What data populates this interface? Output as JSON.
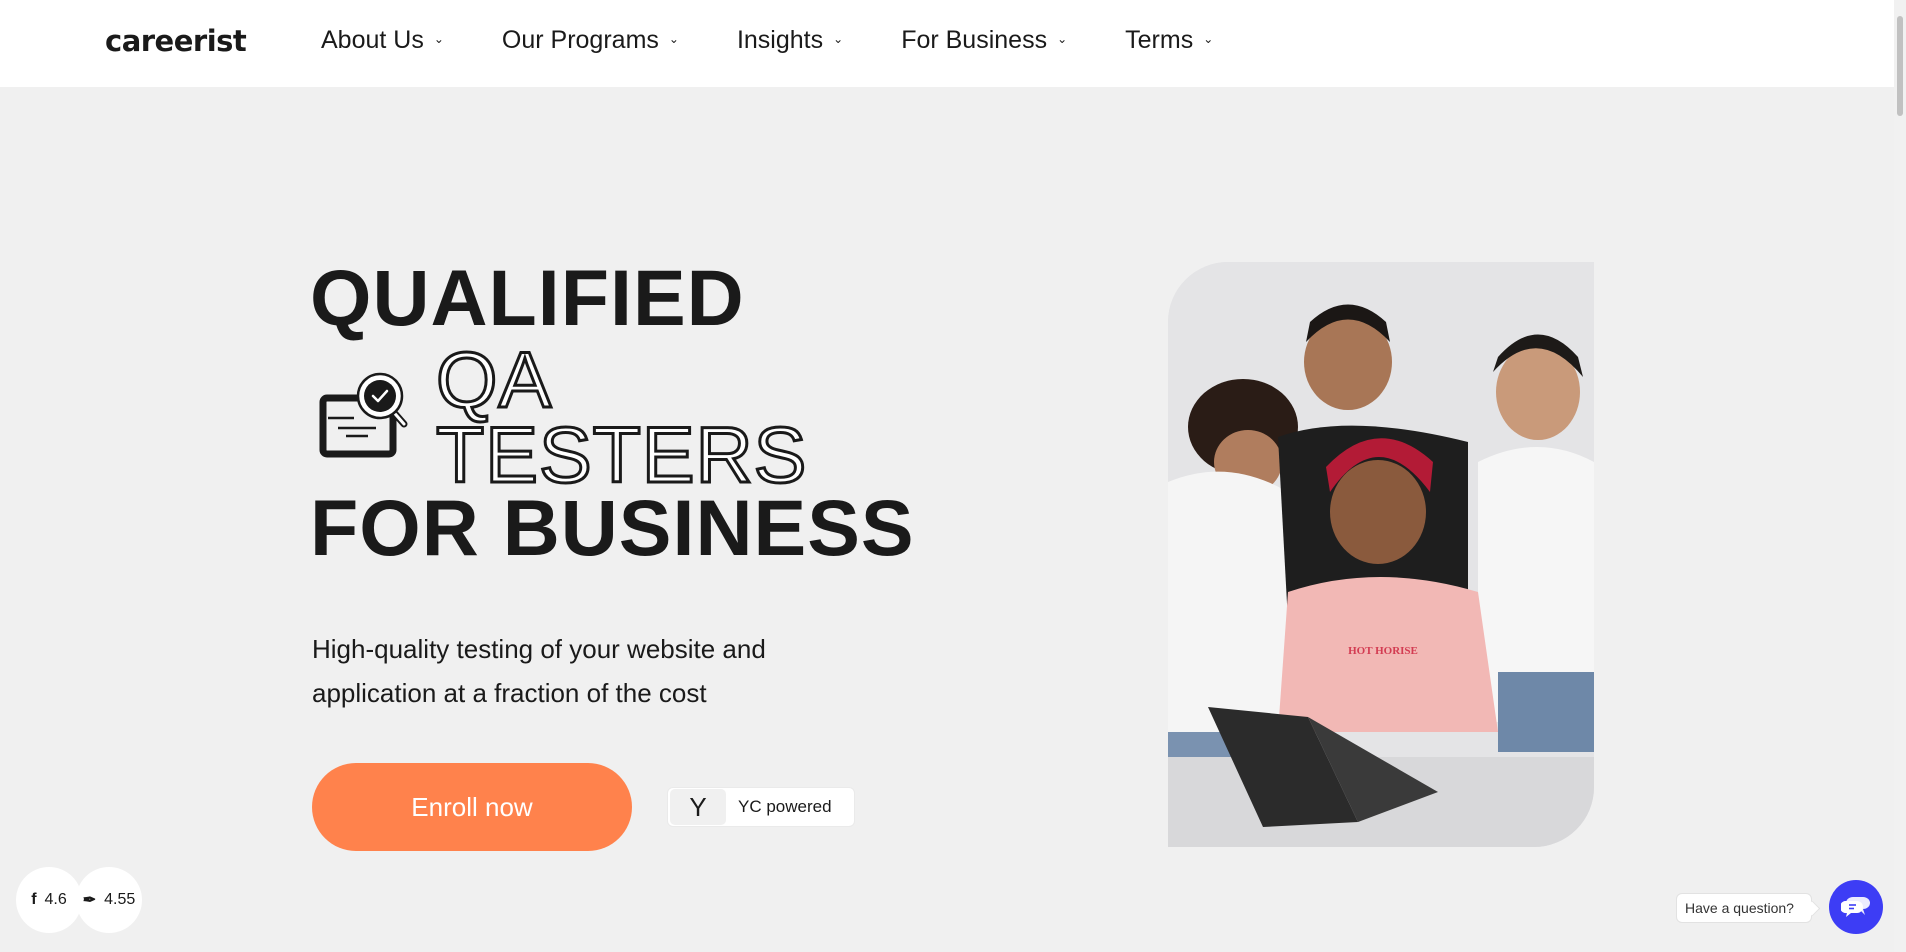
{
  "header": {
    "logo": "careerist",
    "nav": [
      {
        "label": "About Us",
        "icon": "chevron-down-icon"
      },
      {
        "label": "Our Programs",
        "icon": "chevron-down-icon"
      },
      {
        "label": "Insights",
        "icon": "chevron-down-icon"
      },
      {
        "label": "For Business",
        "icon": "chevron-down-icon"
      },
      {
        "label": "Terms",
        "icon": "chevron-down-icon"
      }
    ]
  },
  "hero": {
    "headline": {
      "line1": "QUALIFIED",
      "line2": "QA",
      "line3": "TESTERS",
      "line4": "FOR BUSINESS",
      "icon": "qa-inspection-icon"
    },
    "subtitle": "High-quality testing of your website and application at a fraction of the cost",
    "cta_label": "Enroll now",
    "yc_badge": {
      "mark": "Y",
      "label": "YC powered"
    },
    "photo": {
      "alt": "Four young men smiling at a laptop",
      "shirt_text": "HOT HORISE"
    }
  },
  "ratings": [
    {
      "icon": "facebook-icon",
      "value": "4.6"
    },
    {
      "icon": "review-site-icon",
      "value": "4.55"
    }
  ],
  "chat": {
    "prompt": "Have a question?",
    "icon": "chat-bubbles-icon"
  },
  "colors": {
    "accent": "#ff824c",
    "chat": "#3d3df5",
    "background": "#f0f0f0",
    "text": "#1a1a1a"
  }
}
